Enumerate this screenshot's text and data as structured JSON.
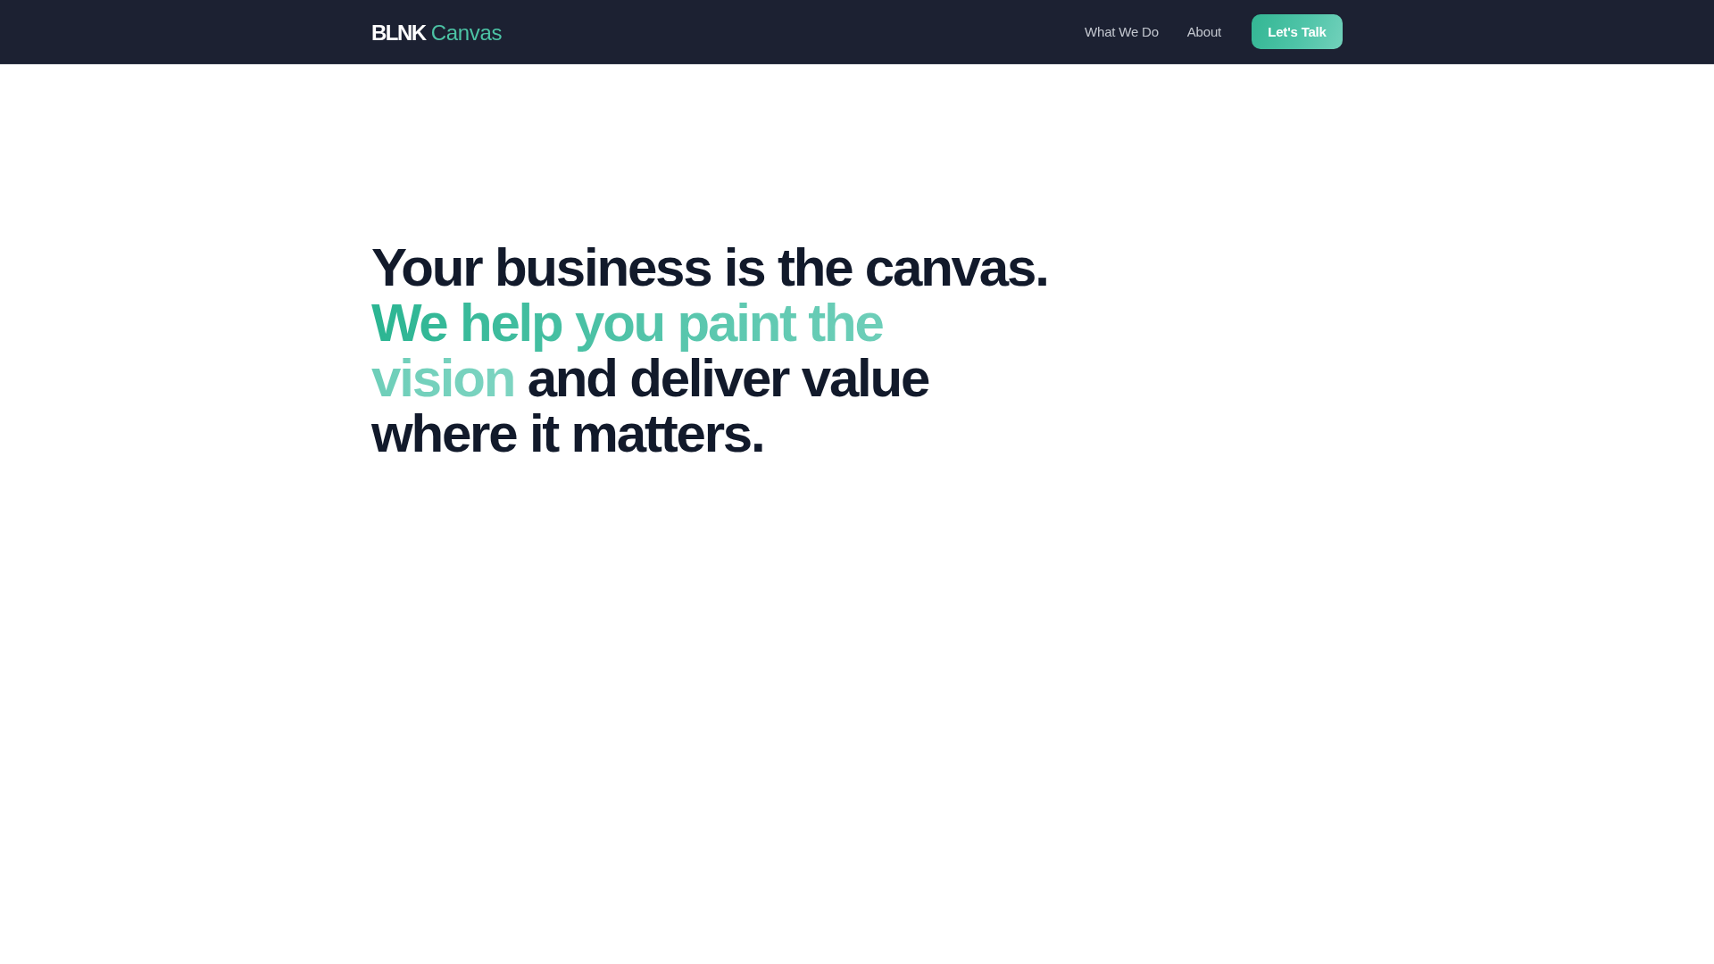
{
  "header": {
    "logo": {
      "brand": "BLNK",
      "product": "Canvas"
    },
    "nav": [
      {
        "label": "What We Do",
        "kind": "link"
      },
      {
        "label": "About",
        "kind": "link"
      },
      {
        "label": "Let's Talk",
        "kind": "cta"
      }
    ]
  },
  "hero": {
    "headline": [
      {
        "kind": "statement",
        "text": "Your business is the canvas."
      },
      {
        "kind": "accent",
        "text": "We help you paint the vision"
      },
      {
        "kind": "plain",
        "text": "and deliver value where it matters."
      }
    ]
  }
}
